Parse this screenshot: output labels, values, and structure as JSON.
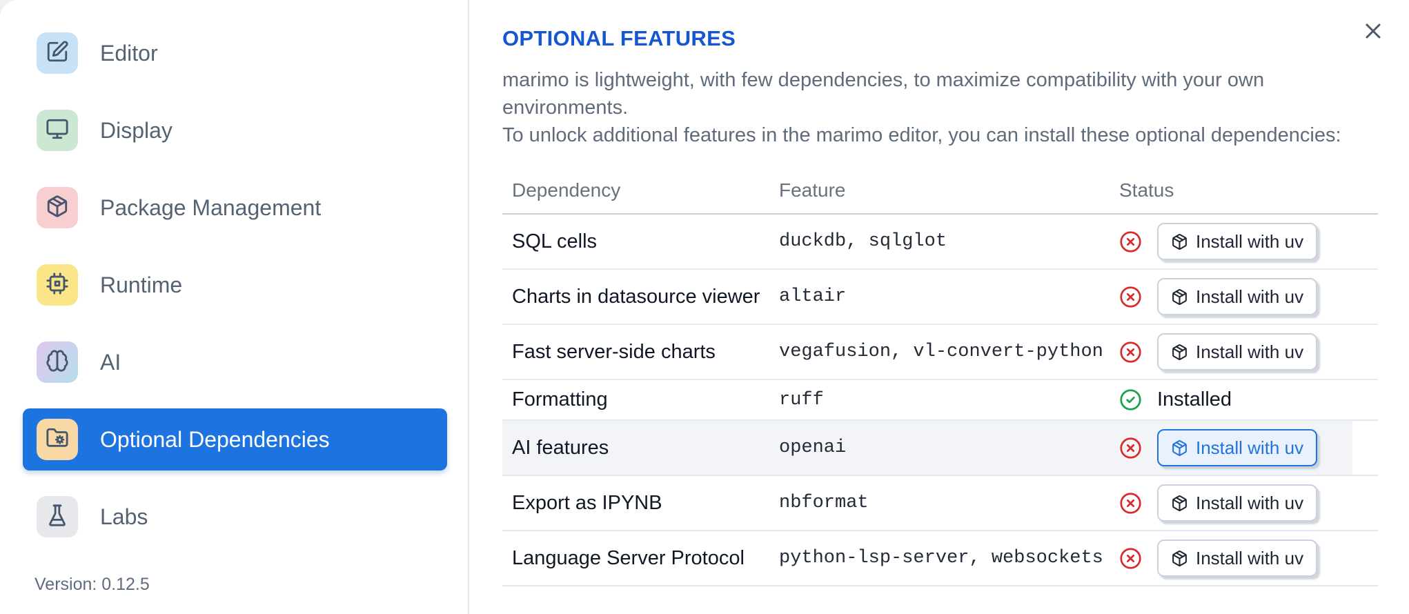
{
  "colors": {
    "accent_blue": "#1d74e0",
    "title_blue": "#1657cf",
    "error_red": "#d92b2b",
    "success_green": "#18a34a"
  },
  "dialog": {
    "close_icon": "close-icon"
  },
  "sidebar": {
    "items": [
      {
        "label": "Editor",
        "icon": "edit-icon",
        "chip_bg": "#c7e2f7",
        "selected": false
      },
      {
        "label": "Display",
        "icon": "monitor-icon",
        "chip_bg": "#cde8d2",
        "selected": false
      },
      {
        "label": "Package Management",
        "icon": "package-icon",
        "chip_bg": "#f9ced1",
        "selected": false
      },
      {
        "label": "Runtime",
        "icon": "cpu-icon",
        "chip_bg": "#fae588",
        "selected": false
      },
      {
        "label": "AI",
        "icon": "brain-icon",
        "chip_bg": "#dcc8ef",
        "chip_bg2": "#b9dcec",
        "selected": false
      },
      {
        "label": "Optional Dependencies",
        "icon": "folder-gear-icon",
        "chip_bg": "#f8d8a4",
        "selected": true
      },
      {
        "label": "Labs",
        "icon": "flask-icon",
        "chip_bg": "#e6e8ec",
        "selected": false
      }
    ],
    "version_label": "Version: 0.12.5"
  },
  "main": {
    "title": "OPTIONAL FEATURES",
    "description_lines": [
      "marimo is lightweight, with few dependencies, to maximize compatibility with your own environments.",
      "To unlock additional features in the marimo editor, you can install these optional dependencies:"
    ],
    "table": {
      "columns": [
        "Dependency",
        "Feature",
        "Status"
      ],
      "status_icons": {
        "missing": "circle-x-icon",
        "installed": "circle-check-icon"
      },
      "action_icon": "package-icon",
      "rows": [
        {
          "dependency": "SQL cells",
          "feature": "duckdb, sqlglot",
          "status": "missing",
          "action": "Install with uv"
        },
        {
          "dependency": "Charts in datasource viewer",
          "feature": "altair",
          "status": "missing",
          "action": "Install with uv"
        },
        {
          "dependency": "Fast server-side charts",
          "feature": "vegafusion, vl-convert-python",
          "status": "missing",
          "action": "Install with uv"
        },
        {
          "dependency": "Formatting",
          "feature": "ruff",
          "status": "installed",
          "status_label": "Installed"
        },
        {
          "dependency": "AI features",
          "feature": "openai",
          "status": "missing",
          "action": "Install with uv",
          "highlighted": true,
          "action_focused": true
        },
        {
          "dependency": "Export as IPYNB",
          "feature": "nbformat",
          "status": "missing",
          "action": "Install with uv"
        },
        {
          "dependency": "Language Server Protocol",
          "feature": "python-lsp-server, websockets",
          "status": "missing",
          "action": "Install with uv"
        }
      ]
    }
  }
}
